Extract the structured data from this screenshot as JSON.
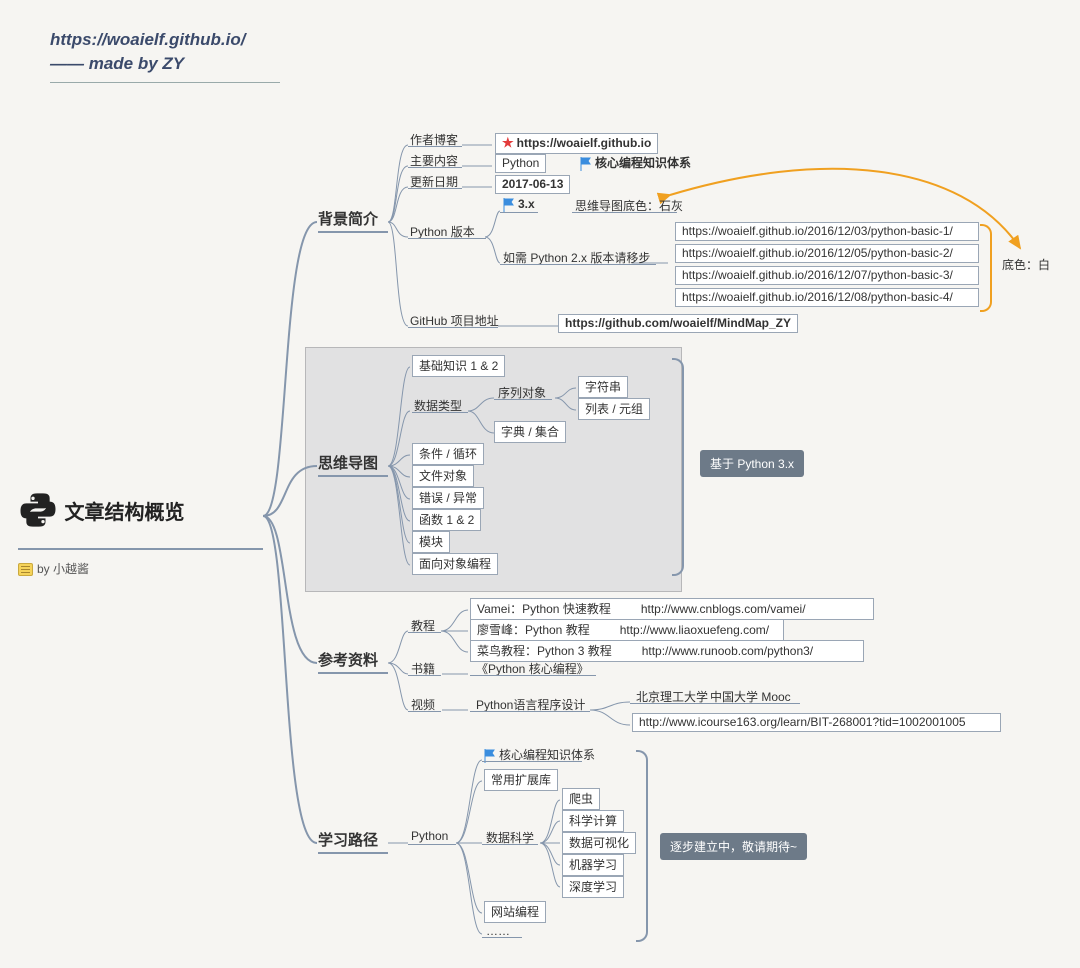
{
  "header": {
    "url": "https://woaielf.github.io/",
    "by": "—— made by ZY"
  },
  "root": {
    "title": "文章结构概览",
    "by": "by 小越酱"
  },
  "branches": {
    "bg": {
      "title": "背景简介",
      "blog_label": "作者博客",
      "blog_url": "https://woaielf.github.io",
      "content_label": "主要内容",
      "content_val": "Python",
      "content_flag": "核心编程知识体系",
      "date_label": "更新日期",
      "date_val": "2017-06-13",
      "ver_label": "Python 版本",
      "ver_3x": "3.x",
      "ver_note": "思维导图底色：石灰",
      "ver_2x": "如需 Python 2.x 版本请移步",
      "links": [
        "https://woaielf.github.io/2016/12/03/python-basic-1/",
        "https://woaielf.github.io/2016/12/05/python-basic-2/",
        "https://woaielf.github.io/2016/12/07/python-basic-3/",
        "https://woaielf.github.io/2016/12/08/python-basic-4/"
      ],
      "github_label": "GitHub 项目地址",
      "github_url": "https://github.com/woaielf/MindMap_ZY",
      "bg_white": "底色：白"
    },
    "mind": {
      "title": "思维导图",
      "basic": "基础知识 1 & 2",
      "data": "数据类型",
      "seq": "序列对象",
      "str": "字符串",
      "list": "列表 / 元组",
      "dict": "字典 / 集合",
      "cond": "条件 / 循环",
      "file": "文件对象",
      "err": "错误 / 异常",
      "func": "函数 1 & 2",
      "mod": "模块",
      "oop": "面向对象编程",
      "note": "基于 Python 3.x"
    },
    "ref": {
      "title": "参考资料",
      "tut": "教程",
      "t1_name": "Vamei：Python 快速教程",
      "t1_url": "http://www.cnblogs.com/vamei/",
      "t2_name": "廖雪峰：Python 教程",
      "t2_url": "http://www.liaoxuefeng.com/",
      "t3_name": "菜鸟教程：Python 3 教程",
      "t3_url": "http://www.runoob.com/python3/",
      "book": "书籍",
      "book_val": "《Python 核心编程》",
      "video": "视频",
      "video_val": "Python语言程序设计",
      "vid_src1": "北京理工大学",
      "vid_src2": "中国大学 Mooc",
      "vid_url": "http://www.icourse163.org/learn/BIT-268001?tid=1002001005"
    },
    "path": {
      "title": "学习路径",
      "core": "核心编程知识体系",
      "lib": "常用扩展库",
      "py": "Python",
      "ds": "数据科学",
      "ds_items": [
        "爬虫",
        "科学计算",
        "数据可视化",
        "机器学习",
        "深度学习"
      ],
      "web": "网站编程",
      "more": "……",
      "note": "逐步建立中，敬请期待~"
    }
  }
}
